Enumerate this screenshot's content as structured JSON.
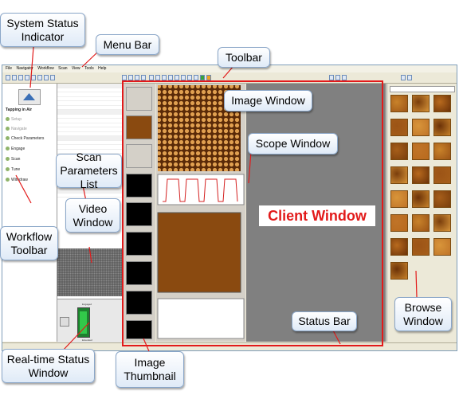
{
  "app": {
    "menu": [
      "File",
      "Navigator",
      "Workflow",
      "Scan",
      "View",
      "Tools",
      "Help"
    ],
    "workflow_items": [
      "Tapping in Air",
      "Setup",
      "Navigate",
      "Check Parameters",
      "Engage",
      "Scan",
      "Tune",
      "Withdraw"
    ],
    "status_labels": [
      "Engaged",
      "Extended"
    ],
    "colors": {
      "client_outline": "#e21a1a",
      "callout_border": "#8aa6c8",
      "afm_brown": "#8a4a10",
      "scope_red": "#d42020"
    }
  },
  "callouts": {
    "system_status": "System Status Indicator",
    "menu_bar": "Menu Bar",
    "toolbar": "Toolbar",
    "image_window": "Image Window",
    "scope_window": "Scope Window",
    "scan_parameters": "Scan Parameters List",
    "client_window": "Client Window",
    "video_window": "Video Window",
    "workflow_toolbar": "Workflow Toolbar",
    "browse_window": "Browse Window",
    "status_bar": "Status Bar",
    "realtime_status": "Real-time Status Window",
    "image_thumbnail": "Image Thumbnail"
  }
}
